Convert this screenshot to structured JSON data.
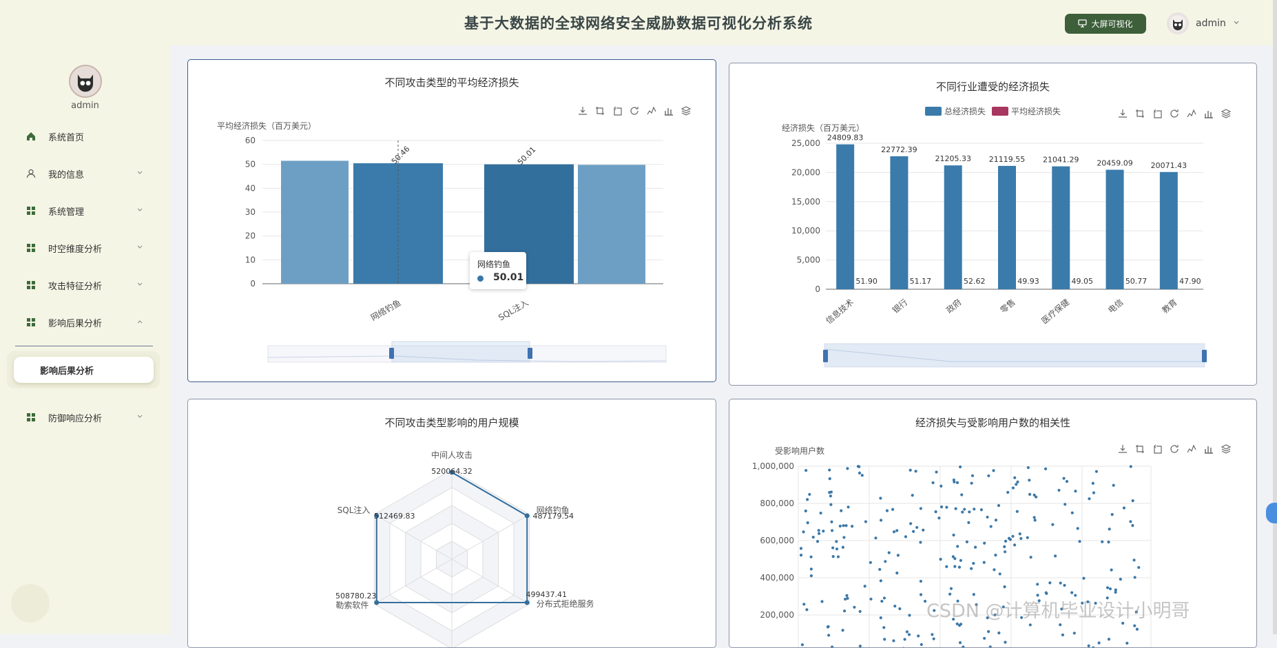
{
  "header": {
    "title": "基于大数据的全球网络安全威胁数据可视化分析系统",
    "bigscreen_label": "大屏可视化",
    "username": "admin"
  },
  "sidebar": {
    "username": "admin",
    "items": [
      {
        "label": "系统首页"
      },
      {
        "label": "我的信息"
      },
      {
        "label": "系统管理"
      },
      {
        "label": "时空维度分析"
      },
      {
        "label": "攻击特征分析"
      },
      {
        "label": "影响后果分析"
      },
      {
        "label": "防御响应分析"
      }
    ],
    "active_sub": "影响后果分析"
  },
  "chart_data": [
    {
      "type": "bar",
      "title": "不同攻击类型的平均经济损失",
      "ylabel": "平均经济损失（百万美元）",
      "ylim": [
        0,
        60
      ],
      "yticks": [
        "0",
        "10",
        "20",
        "30",
        "40",
        "50",
        "60"
      ],
      "categories": [
        "网络钓鱼",
        "SQL注入"
      ],
      "visible_bars": [
        51.5,
        50.46,
        50.01,
        49.8
      ],
      "data_labels": [
        "50.46",
        "50.01"
      ],
      "tooltip": {
        "category": "网络钓鱼",
        "value": "50.01"
      }
    },
    {
      "type": "bar",
      "title": "不同行业遭受的经济损失",
      "ylabel": "经济损失（百万美元）",
      "ylim": [
        0,
        25000
      ],
      "yticks": [
        "0",
        "5,000",
        "10,000",
        "15,000",
        "20,000",
        "25,000"
      ],
      "legend": [
        "总经济损失",
        "平均经济损失"
      ],
      "categories": [
        "信息技术",
        "银行",
        "政府",
        "零售",
        "医疗保健",
        "电信",
        "教育"
      ],
      "series": [
        {
          "name": "总经济损失",
          "values": [
            24809.83,
            22772.39,
            21205.33,
            21119.55,
            21041.29,
            20459.09,
            20071.43
          ],
          "labels": [
            "24809.83",
            "22772.39",
            "21205.33",
            "21119.55",
            "21041.29",
            "20459.09",
            "20071.43"
          ]
        },
        {
          "name": "平均经济损失",
          "values": [
            51.9,
            51.17,
            52.62,
            49.93,
            49.05,
            50.77,
            47.9
          ],
          "labels": [
            "51.90",
            "51.17",
            "52.62",
            "49.93",
            "49.05",
            "50.77",
            "47.90"
          ]
        }
      ]
    },
    {
      "type": "radar",
      "title": "不同攻击类型影响的用户规模",
      "indicators": [
        "中间人攻击",
        "网络钓鱼",
        "分布式拒绝服务",
        "勒索软件",
        "SQL注入"
      ],
      "values": [
        "520064.32",
        "487179.54",
        "499437.41",
        "508780.23",
        "512469.83"
      ]
    },
    {
      "type": "scatter",
      "title": "经济损失与受影响用户数的相关性",
      "ylabel": "受影响用户数",
      "yticks": [
        "200,000",
        "400,000",
        "600,000",
        "800,000",
        "1,000,000"
      ],
      "ylim": [
        200000,
        1000000
      ]
    }
  ],
  "watermark": "CSDN @计算机毕业设计小明哥",
  "colors": {
    "bar": "#3a7bab",
    "bar_light": "#6d9fc4",
    "series2": "#a8365f",
    "accent": "#3d5f3a"
  }
}
